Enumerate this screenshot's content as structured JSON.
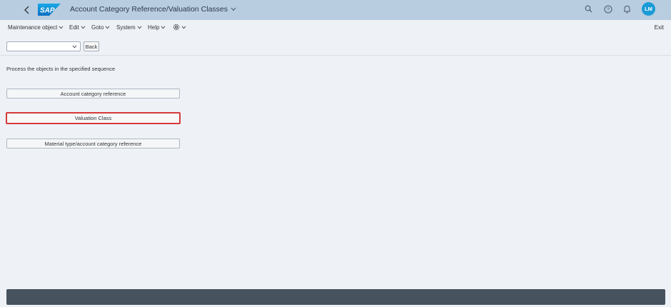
{
  "shell": {
    "title": "Account Category Reference/Valuation Classes",
    "logo_text": "SAP",
    "avatar_initials": "LM",
    "icons": [
      "search-icon",
      "help-icon",
      "bell-icon"
    ],
    "header_color": "#b9cde0",
    "avatar_color": "#1a9bd7"
  },
  "menu": {
    "items": [
      "Maintenance object",
      "Edit",
      "Goto",
      "System",
      "Help"
    ],
    "exit_label": "Exit"
  },
  "toolbar": {
    "combo_value": "",
    "back_label": "Back"
  },
  "content": {
    "instruction": "Process the objects in the specified sequence",
    "objects": [
      {
        "label": "Account category reference",
        "selected": false
      },
      {
        "label": "Valuation Class",
        "selected": true
      },
      {
        "label": "Material type/account category reference",
        "selected": false
      }
    ],
    "selected_border_color": "#d53a3a"
  },
  "footer": {
    "bar_color": "#46525e"
  }
}
